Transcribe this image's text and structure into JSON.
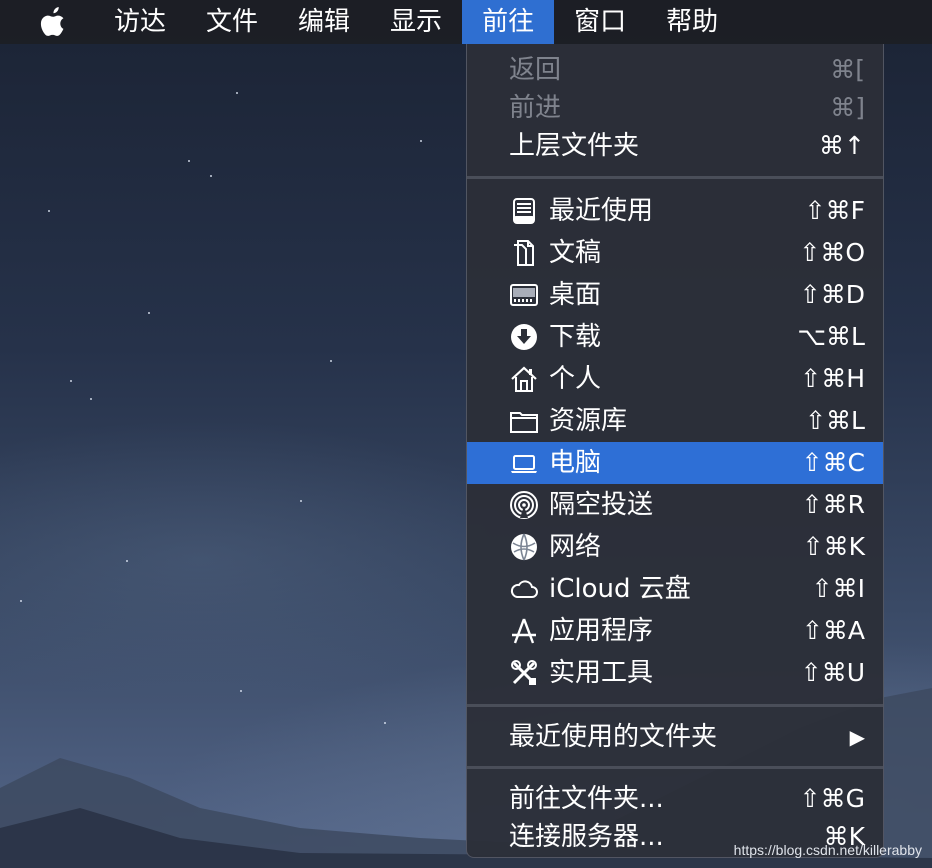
{
  "menubar": {
    "apple_icon": "apple-logo-icon",
    "items": [
      {
        "label": "访达"
      },
      {
        "label": "文件"
      },
      {
        "label": "编辑"
      },
      {
        "label": "显示"
      },
      {
        "label": "前往"
      },
      {
        "label": "窗口"
      },
      {
        "label": "帮助"
      }
    ],
    "active_item": "前往"
  },
  "go_menu": {
    "nav_items": [
      {
        "label": "返回",
        "shortcut": "⌘[",
        "enabled": false
      },
      {
        "label": "前进",
        "shortcut": "⌘]",
        "enabled": false
      },
      {
        "label": "上层文件夹",
        "shortcut": "⌘↑",
        "enabled": true
      }
    ],
    "place_items": [
      {
        "label": "最近使用",
        "shortcut": "⇧⌘F",
        "icon": "recents-icon"
      },
      {
        "label": "文稿",
        "shortcut": "⇧⌘O",
        "icon": "document-icon"
      },
      {
        "label": "桌面",
        "shortcut": "⇧⌘D",
        "icon": "desktop-icon"
      },
      {
        "label": "下载",
        "shortcut": "⌥⌘L",
        "icon": "download-icon"
      },
      {
        "label": "个人",
        "shortcut": "⇧⌘H",
        "icon": "home-icon"
      },
      {
        "label": "资源库",
        "shortcut": "⇧⌘L",
        "icon": "folder-icon"
      },
      {
        "label": "电脑",
        "shortcut": "⇧⌘C",
        "icon": "laptop-icon",
        "highlighted": true
      },
      {
        "label": "隔空投送",
        "shortcut": "⇧⌘R",
        "icon": "airdrop-icon"
      },
      {
        "label": "网络",
        "shortcut": "⇧⌘K",
        "icon": "network-icon"
      },
      {
        "label": "iCloud 云盘",
        "shortcut": "⇧⌘I",
        "icon": "cloud-icon"
      },
      {
        "label": "应用程序",
        "shortcut": "⇧⌘A",
        "icon": "applications-icon"
      },
      {
        "label": "实用工具",
        "shortcut": "⇧⌘U",
        "icon": "utilities-icon"
      }
    ],
    "recent_folders": {
      "label": "最近使用的文件夹",
      "arrow": "▶"
    },
    "goto_items": [
      {
        "label": "前往文件夹...",
        "shortcut": "⇧⌘G"
      },
      {
        "label": "连接服务器...",
        "shortcut": "⌘K"
      }
    ]
  },
  "colors": {
    "highlight": "#2e6fd6",
    "menubar_active": "#2f6fd1",
    "menu_bg": "#2c2f38",
    "disabled_text": "#7f838d"
  },
  "watermark": "https://blog.csdn.net/killerabby"
}
